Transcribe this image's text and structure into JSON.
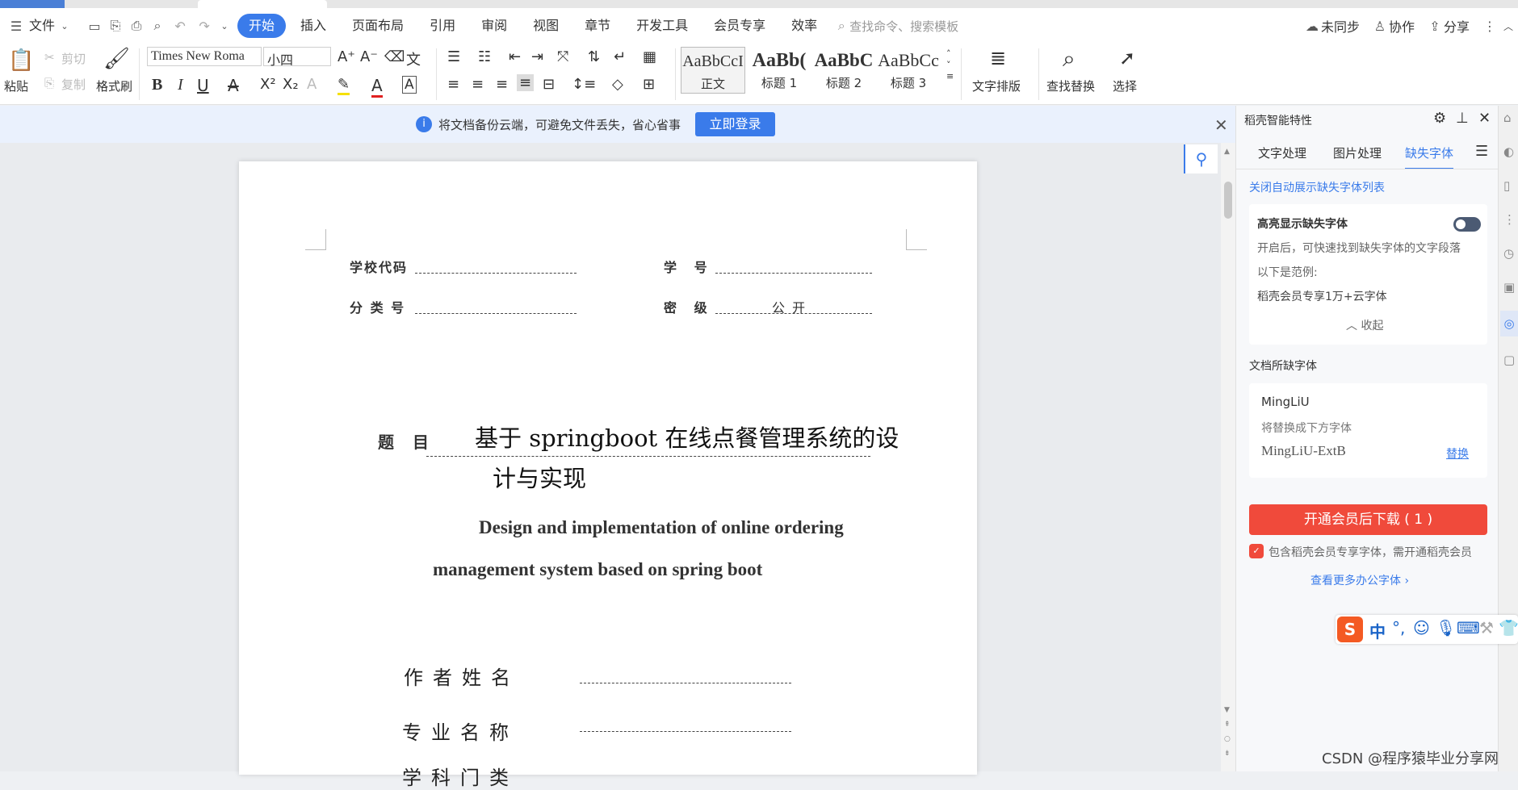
{
  "menubar": {
    "file": "文件",
    "tabs": [
      "开始",
      "插入",
      "页面布局",
      "引用",
      "审阅",
      "视图",
      "章节",
      "开发工具",
      "会员专享",
      "效率"
    ],
    "search_placeholder": "查找命令、搜索模板",
    "unsynced": "未同步",
    "collab": "协作",
    "share": "分享"
  },
  "ribbon": {
    "paste": "粘贴",
    "cut": "剪切",
    "copy": "复制",
    "format_painter": "格式刷",
    "font_name": "Times New Roma",
    "font_size": "小四",
    "styles": [
      {
        "sample": "AaBbCcI",
        "name": "正文"
      },
      {
        "sample": "AaBb(",
        "name": "标题 1"
      },
      {
        "sample": "AaBbC",
        "name": "标题 2"
      },
      {
        "sample": "AaBbCc",
        "name": "标题 3"
      }
    ],
    "text_layout": "文字排版",
    "find_replace": "查找替换",
    "select": "选择"
  },
  "notification": {
    "text": "将文档备份云端，可避免文件丢失，省心省事",
    "button": "立即登录"
  },
  "document": {
    "school_code_label": "学校代码",
    "student_id_label": "学 号",
    "class_no_label": "分 类 号",
    "secret_label": "密 级",
    "secret_value": "公 开",
    "title_label": "题 目",
    "title_cn_1": "基于 springboot 在线点餐管理系统的设",
    "title_cn_2": "计与实现",
    "title_en_1": "Design and implementation of online ordering",
    "title_en_2": "management system based on spring boot",
    "author_label": "作者姓名",
    "major_label": "专业名称",
    "discipline_label": "学科门类"
  },
  "panel": {
    "title": "稻壳智能特性",
    "tabs": [
      "文字处理",
      "图片处理",
      "缺失字体"
    ],
    "close_auto_link": "关闭自动展示缺失字体列表",
    "highlight_label": "高亮显示缺失字体",
    "highlight_desc": "开启后，可快速找到缺失字体的文字段落",
    "example_label": "以下是范例:",
    "example_text": "稻壳会员专享1万+云字体",
    "collapse": "收起",
    "missing_heading": "文档所缺字体",
    "missing_font": "MingLiU",
    "replace_with": "将替换成下方字体",
    "replacement_font": "MingLiU-ExtB",
    "replace_link": "替换",
    "download_button": "开通会员后下载 ( 1 )",
    "member_note": "包含稻壳会员专享字体，需开通稻壳会员",
    "more_fonts": "查看更多办公字体"
  },
  "ime": {
    "lang": "中"
  },
  "watermark": "CSDN @程序猿毕业分享网",
  "colors": {
    "accent": "#3a7bea",
    "download_red": "#f04a3b"
  }
}
